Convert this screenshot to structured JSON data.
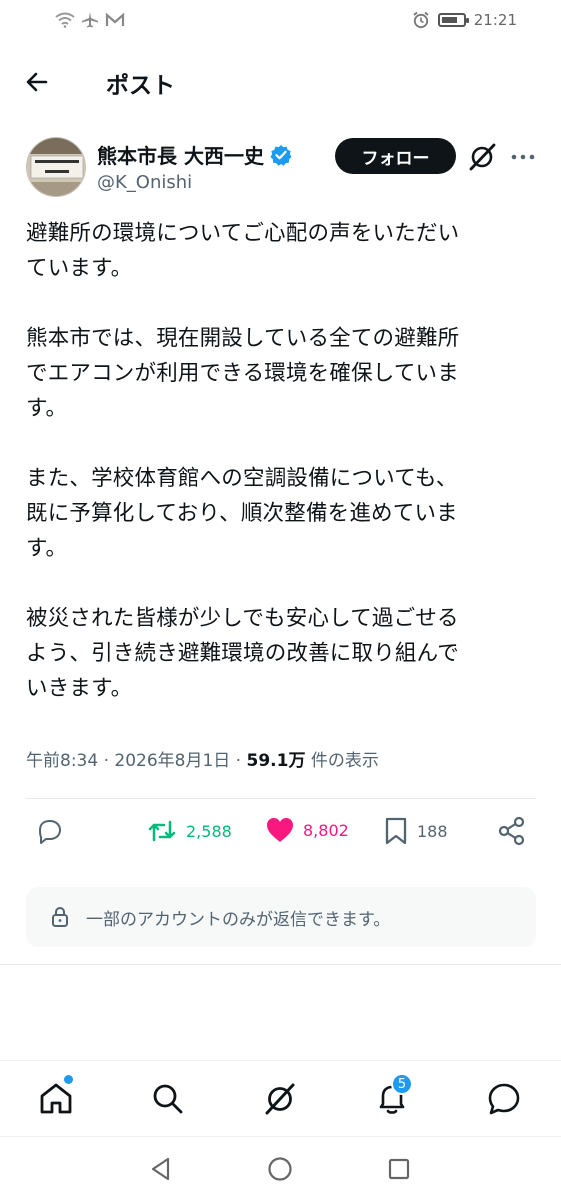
{
  "status_bar": {
    "time": "21:21",
    "left_icons": [
      "wifi-icon",
      "airplane-icon",
      "mail-icon"
    ],
    "right_icons": [
      "alarm-icon",
      "battery-icon"
    ]
  },
  "header": {
    "title": "ポスト"
  },
  "author": {
    "name": "熊本市長 大西一史",
    "handle": "@K_Onishi",
    "verified": true,
    "follow_label": "フォロー"
  },
  "post": {
    "paragraphs": [
      "避難所の環境についてご心配の声をいただい\nています。",
      "熊本市では、現在開設している全ての避難所\nでエアコンが利用できる環境を確保していま\nす。",
      "また、学校体育館への空調設備についても、\n既に予算化しており、順次整備を進めていま\nす。",
      "被災された皆様が少しでも安心して過ごせる\nよう、引き続き避難環境の改善に取り組んで\nいきます。"
    ],
    "time": "午前8:34 · 2026年8月1日 · ",
    "views_count": "59.1万",
    "views_label": " 件の表示"
  },
  "actions": {
    "retweets": "2,588",
    "likes": "8,802",
    "bookmarks": "188"
  },
  "reply_restriction": "一部のアカウントのみが返信できます。",
  "bottom_nav": {
    "notifications_badge": "5"
  },
  "colors": {
    "accent": "#1d9bf0",
    "retweet": "#00ba7c",
    "like": "#f91880",
    "text": "#0f1419",
    "muted": "#536471"
  }
}
